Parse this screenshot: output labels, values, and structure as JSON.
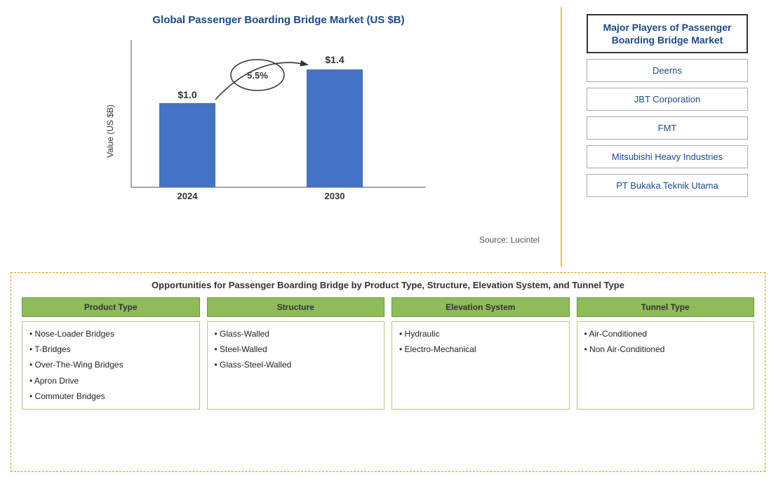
{
  "chart": {
    "title": "Global Passenger Boarding Bridge Market (US $B)",
    "y_axis_label": "Value (US $B)",
    "source": "Source: Lucintel",
    "bars": [
      {
        "year": "2024",
        "value": "$1.0",
        "height_pct": 0.57
      },
      {
        "year": "2030",
        "value": "$1.4",
        "height_pct": 0.8
      }
    ],
    "cagr": "5.5%"
  },
  "major_players": {
    "title": "Major Players of Passenger Boarding Bridge Market",
    "players": [
      "Deerns",
      "JBT Corporation",
      "FMT",
      "Mitsubishi Heavy Industries",
      "PT Bukaka Teknik Utama"
    ]
  },
  "opportunities": {
    "title": "Opportunities for Passenger Boarding Bridge by Product Type, Structure, Elevation System, and Tunnel Type",
    "categories": [
      {
        "header": "Product Type",
        "items": [
          "Nose-Loader Bridges",
          "T-Bridges",
          "Over-The-Wing Bridges",
          "Apron Drive",
          "Commuter Bridges"
        ]
      },
      {
        "header": "Structure",
        "items": [
          "Glass-Walled",
          "Steel-Walled",
          "Glass-Steel-Walled"
        ]
      },
      {
        "header": "Elevation System",
        "items": [
          "Hydraulic",
          "Electro-Mechanical"
        ]
      },
      {
        "header": "Tunnel Type",
        "items": [
          "Air-Conditioned",
          "Non Air-Conditioned"
        ]
      }
    ]
  }
}
